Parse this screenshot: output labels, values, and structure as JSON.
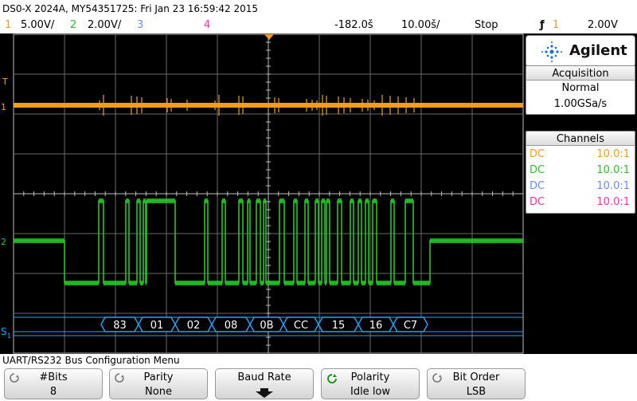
{
  "title": "DS0-X 2024A, MY54351725: Fri Jan 23 16:59:42 2015",
  "status": {
    "ch1_num": "1",
    "ch1_scale": "5.00V/",
    "ch2_num": "2",
    "ch2_scale": "2.00V/",
    "ch3_num": "3",
    "ch4_num": "4",
    "delay": "-182.0š",
    "timebase": "10.00š/",
    "run_state": "Stop",
    "trig_ch": "1",
    "trig_level": "2.00V"
  },
  "colors": {
    "ch1": "#f39c1e",
    "ch2": "#26c426",
    "ch3": "#6b8cff",
    "ch4": "#ff2aa8",
    "bus": "#1ea8ff",
    "grid": "#bdbdbd"
  },
  "brand": "Agilent",
  "acquisition": {
    "header": "Acquisition",
    "mode": "Normal",
    "rate": "1.00GSa/s"
  },
  "channels": {
    "header": "Channels",
    "rows": [
      {
        "coupling": "DC",
        "ratio": "10.0:1",
        "color": "#f39c1e"
      },
      {
        "coupling": "DC",
        "ratio": "10.0:1",
        "color": "#26c426"
      },
      {
        "coupling": "DC",
        "ratio": "10.0:1",
        "color": "#6b8cff"
      },
      {
        "coupling": "DC",
        "ratio": "10.0:1",
        "color": "#ff2aa8"
      }
    ]
  },
  "markers": {
    "trigger": "T",
    "ch1": "1",
    "ch2": "2",
    "serial": "S",
    "serial_sub": "1"
  },
  "bus_bytes": [
    "83",
    "01",
    "02",
    "08",
    "0B",
    "CC",
    "15",
    "16",
    "C7"
  ],
  "menu_title": "UART/RS232 Bus Configuration Menu",
  "softkeys": [
    {
      "label": "#Bits",
      "value": "8",
      "icon": "knob-icon"
    },
    {
      "label": "Parity",
      "value": "None",
      "icon": "knob-icon"
    },
    {
      "label": "Baud Rate",
      "value": "",
      "icon": "down-arrow-icon"
    },
    {
      "label": "Polarity",
      "value": "Idle low",
      "icon": "refresh-icon"
    },
    {
      "label": "Bit Order",
      "value": "LSB",
      "icon": "knob-icon"
    }
  ]
}
